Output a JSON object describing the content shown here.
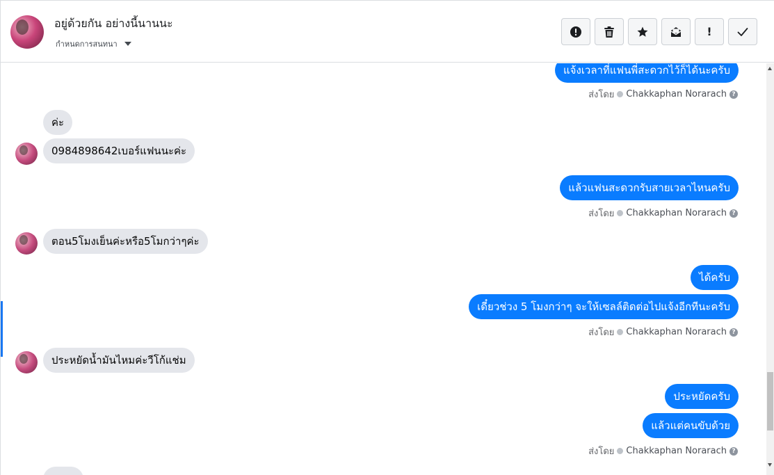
{
  "header": {
    "title": "อยู่ด้วยกัน อย่างนี้นานนะ",
    "subtitle": "กำหนดการสนทนา",
    "toolbar": [
      {
        "name": "mark-spam-button",
        "icon": "alert-circle-icon"
      },
      {
        "name": "delete-button",
        "icon": "trash-icon"
      },
      {
        "name": "star-button",
        "icon": "star-icon"
      },
      {
        "name": "mark-unread-button",
        "icon": "envelope-icon"
      },
      {
        "name": "follow-up-button",
        "icon": "exclamation-icon",
        "glyph": "!"
      },
      {
        "name": "mark-done-button",
        "icon": "check-icon"
      }
    ]
  },
  "thread": {
    "messages": [
      {
        "id": "m0",
        "dir": "out",
        "text": "แจ้งเวลาที่แฟนพี่สะดวกไว้ก็ได้นะครับ"
      },
      {
        "id": "m1",
        "dir": "in",
        "text": "ค่ะ"
      },
      {
        "id": "m2",
        "dir": "in",
        "text": "0984898642เบอร์แฟนนะค่ะ"
      },
      {
        "id": "m3",
        "dir": "out",
        "text": "แล้วแฟนสะดวกรับสายเวลาไหนครับ"
      },
      {
        "id": "m4",
        "dir": "in",
        "text": "ตอน5โมงเย็นค่ะหรือ5โมกว่าๆค่ะ"
      },
      {
        "id": "m5",
        "dir": "out",
        "text": "ได้ครับ"
      },
      {
        "id": "m6",
        "dir": "out",
        "text": "เดี๋ยวช่วง 5 โมงกว่าๆ จะให้เซลล์ติดต่อไปแจ้งอีกทีนะครับ"
      },
      {
        "id": "m7",
        "dir": "in",
        "text": "ประหยัดน้ำมันไหมค่ะวีโก้แช่ม"
      },
      {
        "id": "m8",
        "dir": "out",
        "text": "ประหยัดครับ"
      },
      {
        "id": "m9",
        "dir": "out",
        "text": "แล้วแต่คนขับด้วย"
      }
    ],
    "sent_by": {
      "label": "ส่งโดย",
      "sender": "Chakkaphan Norarach"
    }
  },
  "colors": {
    "outgoing_bubble": "#0a7cff",
    "incoming_bubble": "#e4e6eb",
    "accent": "#1877f2"
  }
}
